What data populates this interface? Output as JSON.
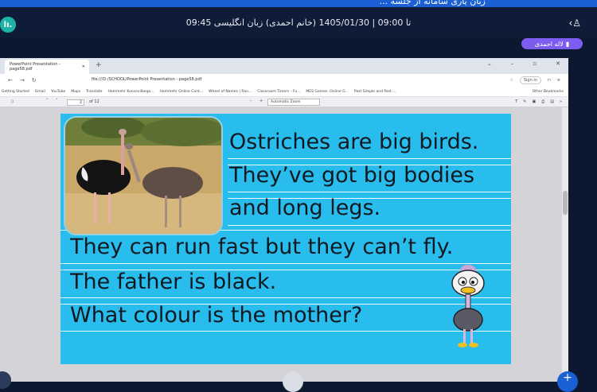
{
  "top_strip": {
    "cut_text": "... زبان یاری سامانه از جلسه"
  },
  "header": {
    "session_title": "09:45 تا 09:00 | 1405/01/30 (خانم احمدی) زبان انگلیسی",
    "user_name": "لاله احمدی"
  },
  "browser": {
    "tab_title": "PowerPoint Presentation - page58.pdf",
    "address": "file:///D:/SCHOOL/PowerPoint Presentation - page58.pdf",
    "sign_in": "Sign in",
    "bookmarks": [
      "Getting Started",
      "Gmail",
      "YouTube",
      "Maps",
      "Translate",
      "Hammehr Konsevilbeqa...",
      "Hammehr Online Cont...",
      "Wheel of Names | Ran...",
      "Classroom Timers - Fu...",
      "MES Games- Online G...",
      "Past Simple and Past ..."
    ],
    "other_bookmarks": "Other Bookmarks"
  },
  "pdf_toolbar": {
    "page_number": "2",
    "page_count": "of 12",
    "zoom": "Automatic Zoom"
  },
  "slide": {
    "line1": "Ostriches are big birds.",
    "line2": "They’ve got big bodies",
    "line3": "and long legs.",
    "line4": "They can run fast but they can’t fly.",
    "line5": "The father is black.",
    "line6": "What colour is the mother?"
  },
  "colors": {
    "slide_bg": "#29bdee",
    "header_bg": "#0e1c37",
    "badge": "#7d5cf0",
    "accent": "#1a5fd4"
  }
}
